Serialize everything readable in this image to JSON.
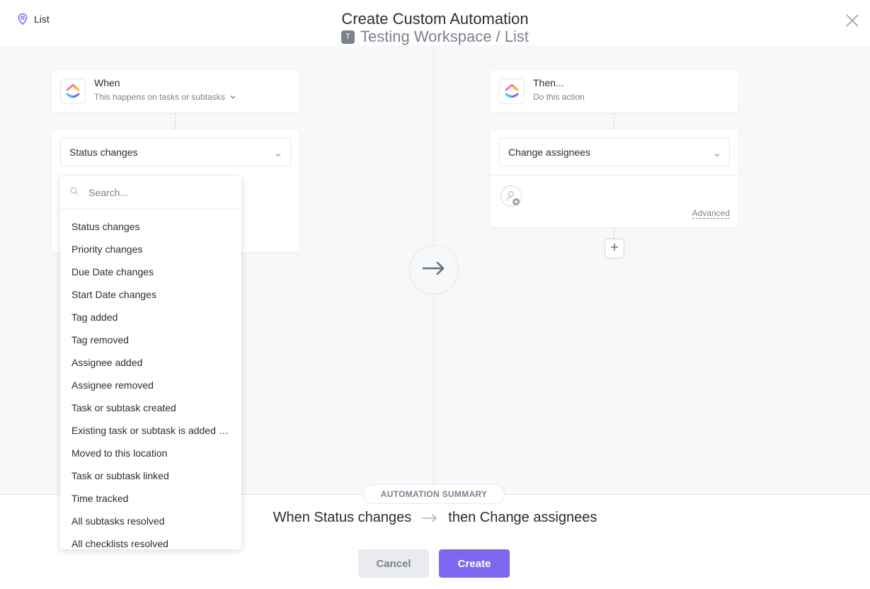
{
  "header": {
    "location_label": "List",
    "title": "Create Custom Automation",
    "workspace_initial": "T",
    "workspace_path": "Testing Workspace / List"
  },
  "trigger": {
    "title": "When",
    "subtitle": "This happens on tasks or subtasks",
    "selected": "Status changes"
  },
  "dropdown": {
    "search_placeholder": "Search...",
    "items": [
      "Status changes",
      "Priority changes",
      "Due Date changes",
      "Start Date changes",
      "Tag added",
      "Tag removed",
      "Assignee added",
      "Assignee removed",
      "Task or subtask created",
      "Existing task or subtask is added to this location",
      "Moved to this location",
      "Task or subtask linked",
      "Time tracked",
      "All subtasks resolved",
      "All checklists resolved"
    ]
  },
  "action": {
    "title": "Then...",
    "subtitle": "Do this action",
    "selected": "Change assignees",
    "advanced_label": "Advanced"
  },
  "summary": {
    "label": "AUTOMATION SUMMARY",
    "when_text": "When Status changes",
    "then_text": "then Change assignees"
  },
  "buttons": {
    "cancel": "Cancel",
    "create": "Create"
  },
  "colors": {
    "accent": "#7b68ee",
    "location_icon": "#7b68ee"
  }
}
